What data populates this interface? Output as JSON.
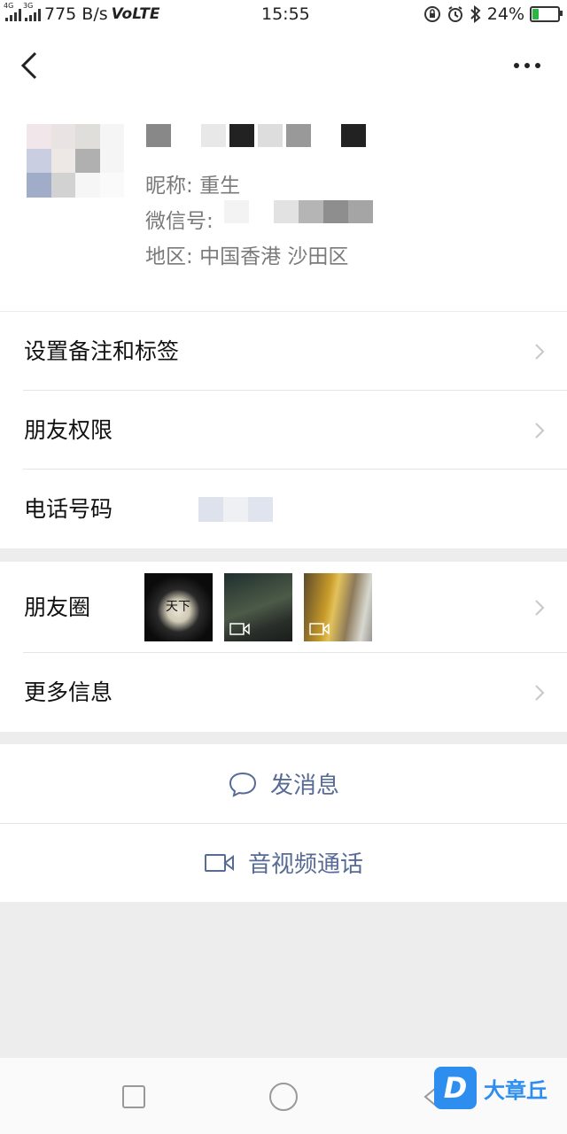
{
  "status_bar": {
    "net_type_1": "4G",
    "net_type_2": "3G",
    "speed": "775 B/s",
    "volte": "VoLTE",
    "time": "15:55",
    "battery": "24%",
    "battery_level": 0.24
  },
  "profile": {
    "nickname_label": "昵称:",
    "nickname_value": "重生",
    "wechat_id_label": "微信号:",
    "region_label": "地区:",
    "region_value": "中国香港  沙田区"
  },
  "menu": {
    "set_remark_tags": "设置备注和标签",
    "friend_permissions": "朋友权限",
    "phone_number": "电话号码",
    "moments": "朋友圈",
    "more_info": "更多信息"
  },
  "moments_thumbs": [
    {
      "type": "image",
      "caption": "天下"
    },
    {
      "type": "video"
    },
    {
      "type": "video"
    }
  ],
  "actions": {
    "send_message": "发消息",
    "video_call": "音视频通话"
  },
  "watermark": {
    "badge": "D",
    "text": "大章丘"
  },
  "colors": {
    "link": "#576b95",
    "background": "#ededed",
    "watermark": "#2d8ef0",
    "battery": "#2fb543"
  }
}
